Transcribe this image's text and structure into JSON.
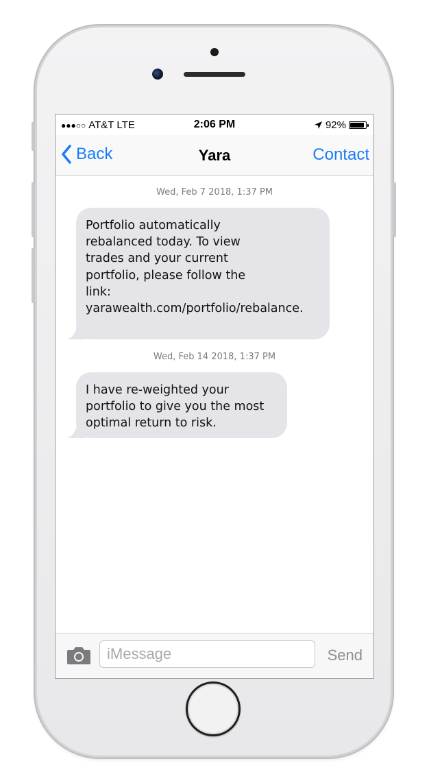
{
  "status_bar": {
    "carrier": "AT&T LTE",
    "signal_bars": "●●●○○",
    "time": "2:06 PM",
    "battery_percent": "92%",
    "battery_level": 0.92
  },
  "nav": {
    "back_label": "Back",
    "title": "Yara",
    "contact_label": "Contact"
  },
  "messages": [
    {
      "timestamp": "Wed, Feb 7 2018, 1:37 PM",
      "text": "Portfolio automatically\nrebalanced today. To view\ntrades and your current\nportfolio, please follow the\nlink:\nyarawealth.com/portfolio/rebalance."
    },
    {
      "timestamp": "Wed, Feb 14 2018, 1:37 PM",
      "text": "I have re-weighted your\nportfolio to give you the most\noptimal return to risk."
    }
  ],
  "input": {
    "placeholder": "iMessage",
    "value": "",
    "send_label": "Send"
  },
  "colors": {
    "accent": "#1a7cf5",
    "bubble": "#e4e4e9",
    "timestamp": "#7b7b7f"
  }
}
